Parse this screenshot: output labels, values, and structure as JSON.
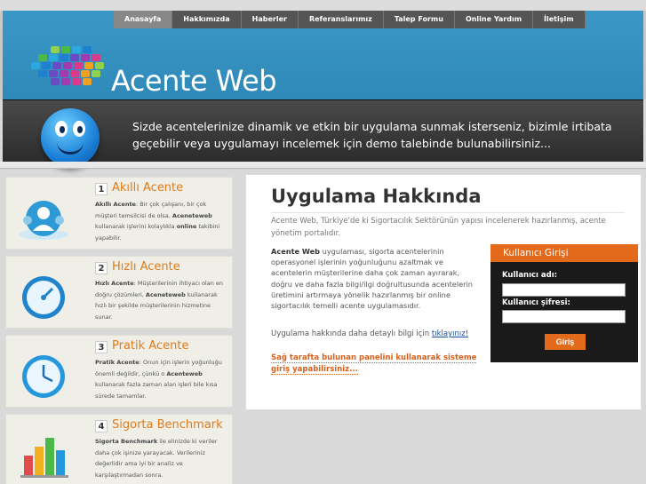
{
  "nav": {
    "items": [
      "Anasayfa",
      "Hakkımızda",
      "Haberler",
      "Referanslarımız",
      "Talep Formu",
      "Online Yardım",
      "İletişim"
    ],
    "active": 0
  },
  "brand": {
    "name": "Acente Web"
  },
  "banner": {
    "text": "Sizde acentelerinize dinamik ve etkin bir uygulama sunmak isterseniz, bizimle irtibata geçebilir veya uygulamayı incelemek için demo talebinde bulunabilirsiniz..."
  },
  "sidebar": {
    "items": [
      {
        "num": "1",
        "title": "Akıllı Acente",
        "icon": "call-center-icon",
        "desc_bold1": "Akıllı Acente",
        "desc1": ": Bir çok çalışanı, bir çok müşteri temsilcisi de olsa, ",
        "desc_bold2": "Aceneteweb",
        "desc2": " kullanarak işlerini kolaylıkla ",
        "desc_bold3": "online",
        "desc3": " takibini yapabilir."
      },
      {
        "num": "2",
        "title": "Hızlı Acente",
        "icon": "speedometer-icon",
        "desc_bold1": "Hızlı Acente",
        "desc1": ": Müşterilerinin ihtiyacı olan en doğru çözümleri, ",
        "desc_bold2": "Aceneteweb",
        "desc2": " kullanarak hızlı bir şekilde müşterilerinin hizmetine sunar.",
        "desc_bold3": "",
        "desc3": ""
      },
      {
        "num": "3",
        "title": "Pratik Acente",
        "icon": "clock-icon",
        "desc_bold1": "Pratik Acente",
        "desc1": ": Onun için işlerin yoğunluğu önemli değildir, çünkü o ",
        "desc_bold2": "Acenteweb",
        "desc2": " kullanarak fazla zaman alan işleri bile kısa sürede tamamlar.",
        "desc_bold3": "",
        "desc3": ""
      },
      {
        "num": "4",
        "title": "Sigorta Benchmark",
        "icon": "bar-chart-icon",
        "desc_bold1": "Sigorta Benchmark",
        "desc1": " ile elinizde ki veriler daha çok işinize yarayacak. Verileriniz değerlidir ama iyi bir analiz ve karşılaştırmadan sonra.",
        "desc_bold2": "",
        "desc2": "",
        "desc_bold3": "",
        "desc3": ""
      }
    ]
  },
  "content": {
    "title": "Uygulama Hakkında",
    "intro": "Acente Web, Türkiye'de ki Sigortacılık Sektörünün yapısı incelenerek hazırlanmış, acente yönetim portalıdır.",
    "para_bold": "Acente Web",
    "para": " uygulaması, sigorta acentelerinin operasyonel işlerinin yoğunluğunu azaltmak ve acentelerin müşterilerine daha çok zaman ayırarak, doğru ve daha fazla bilgi/ilgi doğrultusunda acentelerin üretimini artırmaya yönelik hazırlanmış bir online sigortacılık temelli acente uygulamasıdır.",
    "more_text": "Uygulama hakkında daha detaylı bilgi için ",
    "more_link": "tıklayınız!",
    "login_note": "Sağ tarafta bulunan panelini kullanarak sisteme giriş yapabilirsiniz..."
  },
  "login": {
    "title": "Kullanıcı Girişi",
    "user_label": "Kullanıcı adı:",
    "pass_label": "Kullanıcı şifresi:",
    "button": "Giriş"
  },
  "colors": {
    "accent": "#e46a1b",
    "header_blue": "#3b98c6",
    "banner_dark": "#2c2c2c"
  }
}
